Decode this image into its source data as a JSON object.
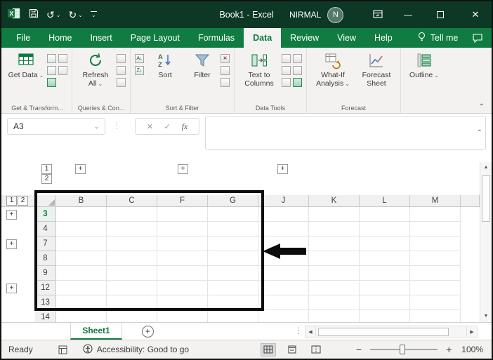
{
  "window": {
    "title": "Book1 - Excel",
    "user_name": "NIRMAL",
    "avatar_initial": "N",
    "controls": {
      "minimize": "—",
      "close": "✕"
    }
  },
  "quick_access": {
    "undo": "↺",
    "redo": "↻",
    "caret": "⌄"
  },
  "menu": {
    "tabs": [
      {
        "label": "File",
        "active": false
      },
      {
        "label": "Home",
        "active": false
      },
      {
        "label": "Insert",
        "active": false
      },
      {
        "label": "Page Layout",
        "active": false
      },
      {
        "label": "Formulas",
        "active": false
      },
      {
        "label": "Data",
        "active": true
      },
      {
        "label": "Review",
        "active": false
      },
      {
        "label": "View",
        "active": false
      },
      {
        "label": "Help",
        "active": false
      }
    ],
    "tell_me": "Tell me"
  },
  "ribbon": {
    "buttons": {
      "get_data": "Get Data",
      "refresh_all": "Refresh All",
      "sort": "Sort",
      "filter": "Filter",
      "text_to_columns": "Text to Columns",
      "what_if_analysis": "What-If Analysis",
      "forecast_sheet": "Forecast Sheet",
      "outline": "Outline"
    },
    "group_labels": {
      "get_transform": "Get & Transform...",
      "queries_connections": "Queries & Con...",
      "sort_filter": "Sort & Filter",
      "data_tools": "Data Tools",
      "forecast": "Forecast"
    },
    "sort_small": {
      "az": "A↓",
      "za": "Z↓"
    }
  },
  "formula_bar": {
    "name_box": "A3",
    "cancel": "✕",
    "enter": "✓",
    "insert_function": "fx",
    "formula_value": ""
  },
  "grid": {
    "columns": [
      "B",
      "C",
      "F",
      "G",
      "J",
      "K",
      "L",
      "M"
    ],
    "rows": [
      "3",
      "4",
      "7",
      "8",
      "9",
      "12",
      "13",
      "14"
    ],
    "active_row": "3",
    "outline": {
      "plus": "+",
      "col_levels": [
        "1",
        "2"
      ],
      "row_levels": [
        "1",
        "2"
      ]
    }
  },
  "sheet_bar": {
    "tabs": [
      {
        "name": "Sheet1",
        "active": true
      }
    ],
    "new_sheet": "+"
  },
  "status_bar": {
    "mode": "Ready",
    "accessibility": "Accessibility: Good to go",
    "zoom_out": "−",
    "zoom_in": "+",
    "zoom_level": "100%"
  },
  "icons": {
    "caret_down": "⌄",
    "collapse_ribbon": "⌃",
    "expand_formula_bar": "⌃",
    "scroll_up": "▲",
    "scroll_down": "▼",
    "scroll_left": "◀",
    "scroll_right": "▶",
    "splitter": "⋮",
    "separator_dots": "⋮",
    "sort_a": "A",
    "sort_z": "Z",
    "app_letter": "X",
    "clear_x": "✕"
  },
  "colors": {
    "title_bar": "#0d3826",
    "ribbon_green": "#107c41",
    "active_tab_text": "#0e7a3e",
    "annotation": "#0c0c0c"
  }
}
